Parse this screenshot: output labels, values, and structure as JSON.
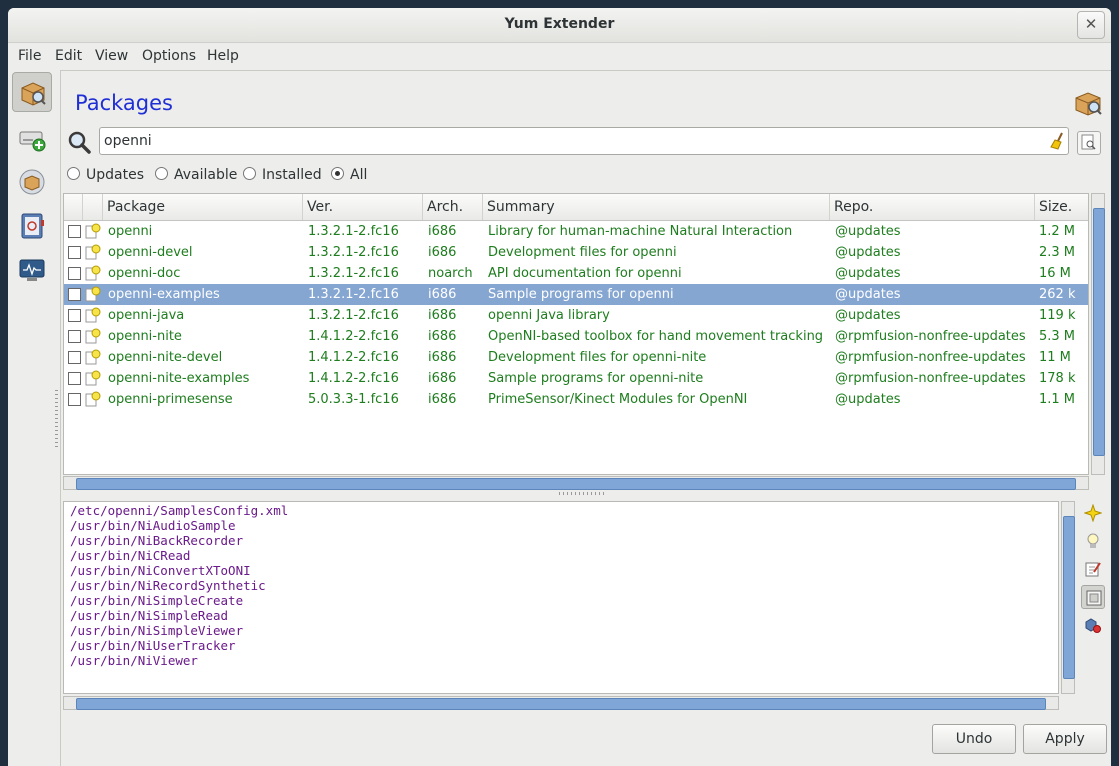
{
  "window": {
    "title": "Yum Extender"
  },
  "menu": [
    "File",
    "Edit",
    "View",
    "Options",
    "Help"
  ],
  "sidebar": [
    {
      "name": "packages-view",
      "icon": "package-search-icon",
      "active": true
    },
    {
      "name": "repositories-view",
      "icon": "drive-add-icon"
    },
    {
      "name": "groups-view",
      "icon": "package-group-icon"
    },
    {
      "name": "history-view",
      "icon": "history-book-icon"
    },
    {
      "name": "output-view",
      "icon": "monitor-icon"
    }
  ],
  "page": {
    "title": "Packages"
  },
  "search": {
    "value": "openni",
    "placeholder": ""
  },
  "filters": [
    {
      "label": "Updates",
      "checked": false
    },
    {
      "label": "Available",
      "checked": false
    },
    {
      "label": "Installed",
      "checked": false
    },
    {
      "label": "All",
      "checked": true
    }
  ],
  "table": {
    "columns": [
      "Package",
      "Ver.",
      "Arch.",
      "Summary",
      "Repo.",
      "Size."
    ],
    "rows": [
      {
        "package": "openni",
        "ver": "1.3.2.1-2.fc16",
        "arch": "i686",
        "summary": "Library for human-machine Natural Interaction",
        "repo": "@updates",
        "size": "1.2 M"
      },
      {
        "package": "openni-devel",
        "ver": "1.3.2.1-2.fc16",
        "arch": "i686",
        "summary": "Development files for openni",
        "repo": "@updates",
        "size": "2.3 M"
      },
      {
        "package": "openni-doc",
        "ver": "1.3.2.1-2.fc16",
        "arch": "noarch",
        "summary": "API documentation for openni",
        "repo": "@updates",
        "size": "16 M"
      },
      {
        "package": "openni-examples",
        "ver": "1.3.2.1-2.fc16",
        "arch": "i686",
        "summary": "Sample programs for openni",
        "repo": "@updates",
        "size": "262 k",
        "selected": true
      },
      {
        "package": "openni-java",
        "ver": "1.3.2.1-2.fc16",
        "arch": "i686",
        "summary": "openni Java library",
        "repo": "@updates",
        "size": "119 k"
      },
      {
        "package": "openni-nite",
        "ver": "1.4.1.2-2.fc16",
        "arch": "i686",
        "summary": "OpenNI-based toolbox for hand movement tracking",
        "repo": "@rpmfusion-nonfree-updates",
        "size": "5.3 M"
      },
      {
        "package": "openni-nite-devel",
        "ver": "1.4.1.2-2.fc16",
        "arch": "i686",
        "summary": "Development files for openni-nite",
        "repo": "@rpmfusion-nonfree-updates",
        "size": "11 M"
      },
      {
        "package": "openni-nite-examples",
        "ver": "1.4.1.2-2.fc16",
        "arch": "i686",
        "summary": "Sample programs for openni-nite",
        "repo": "@rpmfusion-nonfree-updates",
        "size": "178 k"
      },
      {
        "package": "openni-primesense",
        "ver": "5.0.3.3-1.fc16",
        "arch": "i686",
        "summary": "PrimeSensor/Kinect Modules for OpenNI",
        "repo": "@updates",
        "size": "1.1 M"
      }
    ]
  },
  "files": [
    "/etc/openni/SamplesConfig.xml",
    "/usr/bin/NiAudioSample",
    "/usr/bin/NiBackRecorder",
    "/usr/bin/NiCRead",
    "/usr/bin/NiConvertXToONI",
    "/usr/bin/NiRecordSynthetic",
    "/usr/bin/NiSimpleCreate",
    "/usr/bin/NiSimpleRead",
    "/usr/bin/NiSimpleViewer",
    "/usr/bin/NiUserTracker",
    "/usr/bin/NiViewer"
  ],
  "info_tools": [
    {
      "name": "description-tool",
      "icon": "sparkle-icon"
    },
    {
      "name": "updateinfo-tool",
      "icon": "bulb-icon"
    },
    {
      "name": "changelog-tool",
      "icon": "notepad-icon"
    },
    {
      "name": "files-tool",
      "icon": "file-list-icon",
      "active": true
    },
    {
      "name": "deps-tool",
      "icon": "dependencies-icon"
    }
  ],
  "buttons": {
    "undo": "Undo",
    "apply": "Apply"
  },
  "colors": {
    "accent_title": "#1f2fd6",
    "package_text": "#1e7d1e",
    "selected_row": "#86a6d2",
    "file_text": "#6a1a8a"
  }
}
